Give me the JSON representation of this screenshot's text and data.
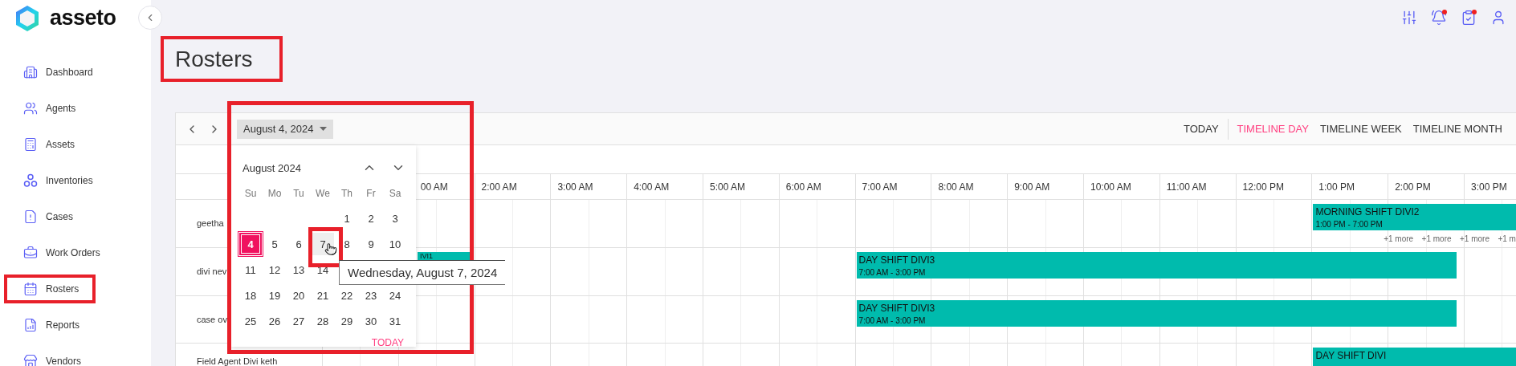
{
  "sidebar": {
    "logo": {
      "name": "asseto"
    },
    "items": [
      {
        "kind": "dashboard",
        "label": "Dashboard",
        "highlighted": false
      },
      {
        "kind": "agents",
        "label": "Agents",
        "highlighted": false
      },
      {
        "kind": "assets",
        "label": "Assets",
        "highlighted": false
      },
      {
        "kind": "inventories",
        "label": "Inventories",
        "highlighted": false
      },
      {
        "kind": "cases",
        "label": "Cases",
        "highlighted": false
      },
      {
        "kind": "work_orders",
        "label": "Work Orders",
        "highlighted": false
      },
      {
        "kind": "rosters",
        "label": "Rosters",
        "highlighted": true
      },
      {
        "kind": "reports",
        "label": "Reports",
        "highlighted": false
      },
      {
        "kind": "vendors",
        "label": "Vendors",
        "highlighted": false
      }
    ]
  },
  "top_bar": {
    "icons": [
      {
        "kind": "sliders",
        "dot": false
      },
      {
        "kind": "bell",
        "dot": true
      },
      {
        "kind": "clipboard",
        "dot": true
      },
      {
        "kind": "user",
        "dot": false
      }
    ]
  },
  "page_title": {
    "text": "Rosters",
    "highlighted": true
  },
  "scheduler": {
    "toolbar": {
      "date": "August 4, 2024",
      "today": "TODAY",
      "views": [
        {
          "label": "TIMELINE DAY",
          "selected": true
        },
        {
          "label": "TIMELINE WEEK",
          "selected": false
        },
        {
          "label": "TIMELINE MONTH",
          "selected": false
        }
      ]
    },
    "hours": [
      "00 AM",
      "2:00 AM",
      "3:00 AM",
      "4:00 AM",
      "5:00 AM",
      "6:00 AM",
      "7:00 AM",
      "8:00 AM",
      "9:00 AM",
      "10:00 AM",
      "11:00 AM",
      "12:00 PM",
      "1:00 PM",
      "2:00 PM",
      "3:00 PM"
    ],
    "rows": [
      {
        "name": "geetha",
        "events": [
          {
            "kind": "full",
            "title": "MORNING SHIFT DIVI2",
            "time": "1:00 PM - 7:00 PM"
          }
        ],
        "more": [
          "+1 more",
          "+1 more",
          "+1 more",
          "+1 m"
        ]
      },
      {
        "name": "divi nev",
        "events": [
          {
            "kind": "stub",
            "title": "IVI1"
          },
          {
            "kind": "full",
            "title": "DAY SHIFT DIVI3",
            "time": "7:00 AM - 3:00 PM"
          }
        ]
      },
      {
        "name": "case ov",
        "events": [
          {
            "kind": "full",
            "title": "DAY SHIFT DIVI3",
            "time": "7:00 AM - 3:00 PM"
          }
        ]
      },
      {
        "name": "Field Agent Divi keth",
        "events": [
          {
            "kind": "full",
            "title": "DAY SHIFT DIVI"
          }
        ]
      }
    ]
  },
  "calendar_popup": {
    "highlighted": true,
    "month": "August 2024",
    "weekdays": [
      "Su",
      "Mo",
      "Tu",
      "We",
      "Th",
      "Fr",
      "Sa"
    ],
    "weeks": [
      [
        {
          "day": "1",
          "selected": false,
          "hovered": false,
          "highlighted": false
        },
        {
          "day": "2",
          "selected": false,
          "hovered": false,
          "highlighted": false
        },
        {
          "day": "3",
          "selected": false,
          "hovered": false,
          "highlighted": false
        }
      ],
      [
        {
          "day": "4",
          "selected": true,
          "hovered": false,
          "highlighted": false
        },
        {
          "day": "5",
          "selected": false,
          "hovered": false,
          "highlighted": false
        },
        {
          "day": "6",
          "selected": false,
          "hovered": false,
          "highlighted": false
        },
        {
          "day": "7",
          "selected": false,
          "hovered": true,
          "highlighted": true
        },
        {
          "day": "8",
          "selected": false,
          "hovered": false,
          "highlighted": false
        },
        {
          "day": "9",
          "selected": false,
          "hovered": false,
          "highlighted": false
        },
        {
          "day": "10",
          "selected": false,
          "hovered": false,
          "highlighted": false
        }
      ],
      [
        {
          "day": "11",
          "selected": false,
          "hovered": false,
          "highlighted": false
        },
        {
          "day": "12",
          "selected": false,
          "hovered": false,
          "highlighted": false
        },
        {
          "day": "13",
          "selected": false,
          "hovered": false,
          "highlighted": false
        },
        {
          "day": "14",
          "selected": false,
          "hovered": false,
          "highlighted": false
        }
      ],
      [
        {
          "day": "18",
          "selected": false,
          "hovered": false,
          "highlighted": false
        },
        {
          "day": "19",
          "selected": false,
          "hovered": false,
          "highlighted": false
        },
        {
          "day": "20",
          "selected": false,
          "hovered": false,
          "highlighted": false
        },
        {
          "day": "21",
          "selected": false,
          "hovered": false,
          "highlighted": false
        },
        {
          "day": "22",
          "selected": false,
          "hovered": false,
          "highlighted": false
        },
        {
          "day": "23",
          "selected": false,
          "hovered": false,
          "highlighted": false
        },
        {
          "day": "24",
          "selected": false,
          "hovered": false,
          "highlighted": false
        }
      ],
      [
        {
          "day": "25",
          "selected": false,
          "hovered": false,
          "highlighted": false
        },
        {
          "day": "26",
          "selected": false,
          "hovered": false,
          "highlighted": false
        },
        {
          "day": "27",
          "selected": false,
          "hovered": false,
          "highlighted": false
        },
        {
          "day": "28",
          "selected": false,
          "hovered": false,
          "highlighted": false
        },
        {
          "day": "29",
          "selected": false,
          "hovered": false,
          "highlighted": false
        },
        {
          "day": "30",
          "selected": false,
          "hovered": false,
          "highlighted": false
        },
        {
          "day": "31",
          "selected": false,
          "hovered": false,
          "highlighted": false
        }
      ]
    ],
    "today": "TODAY",
    "tooltip": "Wednesday, August 7, 2024"
  }
}
